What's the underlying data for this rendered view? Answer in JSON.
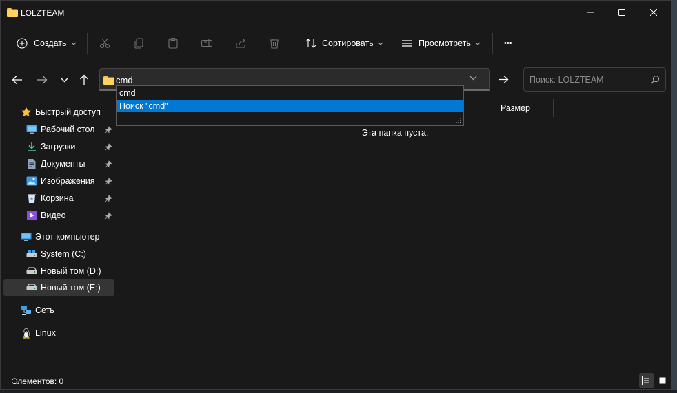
{
  "window": {
    "title": "LOLZTEAM"
  },
  "toolbar": {
    "new_label": "Создать",
    "sort_label": "Сортировать",
    "view_label": "Просмотреть",
    "more_label": "•••"
  },
  "address": {
    "value": "cmd",
    "suggestions": [
      "cmd",
      "Поиск \"cmd\""
    ]
  },
  "search": {
    "placeholder": "Поиск: LOLZTEAM"
  },
  "nav": {
    "quick_access": "Быстрый доступ",
    "items": [
      {
        "label": "Рабочий стол",
        "icon": "desktop-icon",
        "pinned": true
      },
      {
        "label": "Загрузки",
        "icon": "downloads-icon",
        "pinned": true
      },
      {
        "label": "Документы",
        "icon": "documents-icon",
        "pinned": true
      },
      {
        "label": "Изображения",
        "icon": "pictures-icon",
        "pinned": true
      },
      {
        "label": "Корзина",
        "icon": "recycle-bin-icon",
        "pinned": true
      },
      {
        "label": "Видео",
        "icon": "videos-icon",
        "pinned": true
      }
    ],
    "this_pc": "Этот компьютер",
    "drives": [
      {
        "label": "System (C:)",
        "icon": "system-drive-icon"
      },
      {
        "label": "Новый том (D:)",
        "icon": "drive-icon"
      },
      {
        "label": "Новый том (E:)",
        "icon": "drive-icon",
        "selected": true
      }
    ],
    "network": "Сеть",
    "linux": "Linux"
  },
  "content": {
    "column_size": "Размер",
    "empty_message": "Эта папка пуста."
  },
  "status": {
    "items_count": "Элементов: 0"
  },
  "colors": {
    "accent": "#0078d4",
    "folder": "#f6c443",
    "background": "#191919"
  }
}
